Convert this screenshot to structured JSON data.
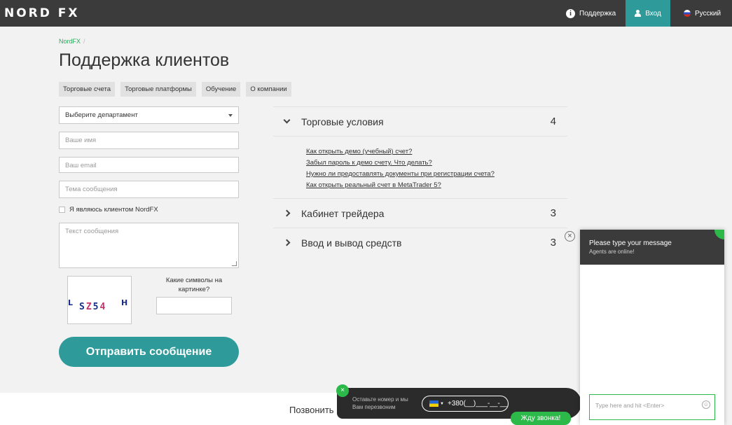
{
  "header": {
    "logo": "NORD FX",
    "support": "Поддержка",
    "login": "Вход",
    "language": "Русский",
    "accent_color": "#2e9a9a"
  },
  "breadcrumb": {
    "home": "NordFX",
    "separator": "/"
  },
  "page_title": "Поддержка клиентов",
  "tabs": [
    "Торговые счета",
    "Торговые платформы",
    "Обучение",
    "О компании"
  ],
  "form": {
    "department_select": "Выберите департамент",
    "name_placeholder": "Ваше имя",
    "email_placeholder": "Ваш email",
    "subject_placeholder": "Тема сообщения",
    "client_checkbox": "Я являюсь клиентом NordFX",
    "message_placeholder": "Текст сообщения",
    "captcha_question": "Какие символы на картинке?",
    "captcha_chars": [
      "L",
      "S",
      "Z",
      "5",
      "4",
      "H"
    ],
    "submit": "Отправить сообщение"
  },
  "faq": [
    {
      "title": "Торговые условия",
      "count": "4",
      "expanded": true,
      "links": [
        "Как открыть демо (учебный) счет?",
        "Забыл пароль к демо счету. Что делать?",
        "Нужно ли предоставлять документы при регистрации счета?",
        "Как открыть реальный счет в MetaTrader 5?"
      ]
    },
    {
      "title": "Кабинет трейдера",
      "count": "3",
      "expanded": false
    },
    {
      "title": "Ввод и вывод средств",
      "count": "3",
      "expanded": false
    }
  ],
  "chat": {
    "title": "Please type your message",
    "subtitle": "Agents are online!",
    "input_placeholder": "Type here and hit <Enter>"
  },
  "callback": {
    "label": "Позвонить",
    "prompt": "Оставьте номер и мы Вам перезвоним",
    "phone_mask": "+380(__)___-__-__",
    "button": "Жду звонка!"
  }
}
